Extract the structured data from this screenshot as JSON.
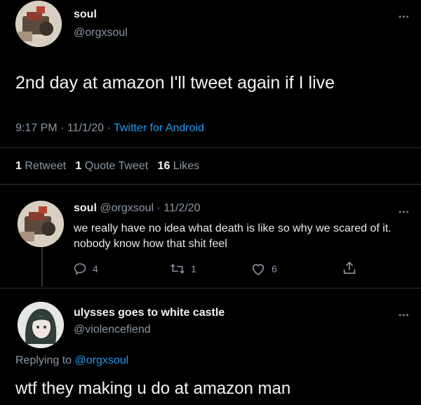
{
  "tweet": {
    "author": {
      "display_name": "soul",
      "handle": "@orgxsoul"
    },
    "text": "2nd day at amazon I'll tweet again if I live",
    "time": "9:17 PM",
    "date": "11/1/20",
    "separator": "·",
    "source": "Twitter for Android",
    "stats": {
      "retweets_count": "1",
      "retweets_label": "Retweet",
      "quotes_count": "1",
      "quotes_label": "Quote Tweet",
      "likes_count": "16",
      "likes_label": "Likes"
    },
    "more_icon": "more-horizontal-icon"
  },
  "reply1": {
    "author": {
      "display_name": "soul",
      "handle": "@orgxsoul"
    },
    "date": "11/2/20",
    "separator": "·",
    "text": "we really have no idea what death is like so why we scared of it. nobody know how that shit feel",
    "actions": {
      "reply_count": "4",
      "retweet_count": "1",
      "like_count": "6"
    },
    "icons": [
      "reply-icon",
      "retweet-icon",
      "like-icon",
      "share-icon"
    ]
  },
  "reply2": {
    "author": {
      "display_name": "ulysses goes to white castle",
      "handle": "@violencefiend"
    },
    "replying_prefix": "Replying to",
    "replying_handle": "@orgxsoul",
    "text": "wtf they making u do at amazon man"
  },
  "colors": {
    "background": "#000000",
    "link": "#1d9bf0",
    "muted": "#8b98a5",
    "text": "#e7e9ea"
  }
}
